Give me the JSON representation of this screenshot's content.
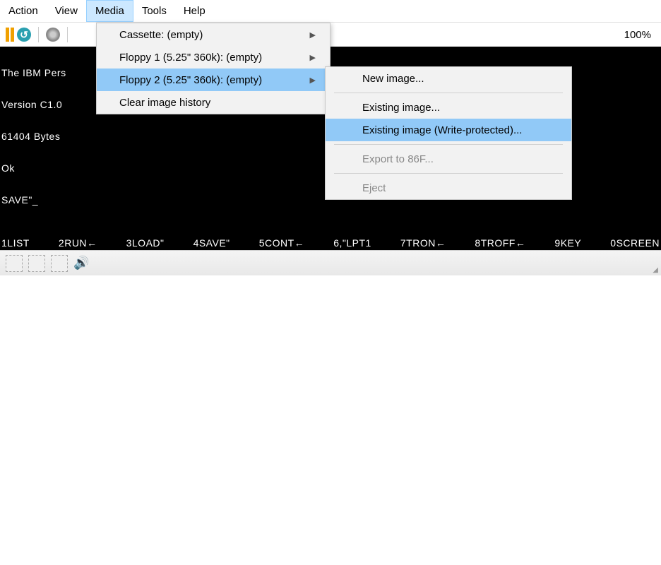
{
  "menubar": {
    "items": [
      {
        "label": "Action"
      },
      {
        "label": "View"
      },
      {
        "label": "Media"
      },
      {
        "label": "Tools"
      },
      {
        "label": "Help"
      }
    ],
    "selected_index": 2
  },
  "toolbar": {
    "zoom_label": "100%"
  },
  "media_menu": {
    "items": [
      {
        "label": "Cassette: (empty)",
        "submenu": true
      },
      {
        "label": "Floppy 1 (5.25\" 360k): (empty)",
        "submenu": true
      },
      {
        "label": "Floppy 2 (5.25\" 360k): (empty)",
        "submenu": true,
        "highlight": true
      },
      {
        "label": "Clear image history"
      }
    ]
  },
  "submenu": {
    "items": [
      {
        "label": "New image..."
      },
      {
        "sep": true
      },
      {
        "label": "Existing image..."
      },
      {
        "label": "Existing image (Write-protected)...",
        "highlight": true
      },
      {
        "sep": true
      },
      {
        "label": "Export to 86F...",
        "disabled": true
      },
      {
        "sep": true
      },
      {
        "label": "Eject",
        "disabled": true
      }
    ]
  },
  "emulator": {
    "lines": [
      "The IBM Pers",
      "Version C1.0",
      "61404 Bytes",
      "Ok",
      "SAVE\"_"
    ],
    "fnkeys": [
      "1LIST",
      "2RUN←",
      "3LOAD\"",
      "4SAVE\"",
      "5CONT←",
      "6,\"LPT1",
      "7TRON←",
      "8TROFF←",
      "9KEY",
      "0SCREEN"
    ]
  }
}
